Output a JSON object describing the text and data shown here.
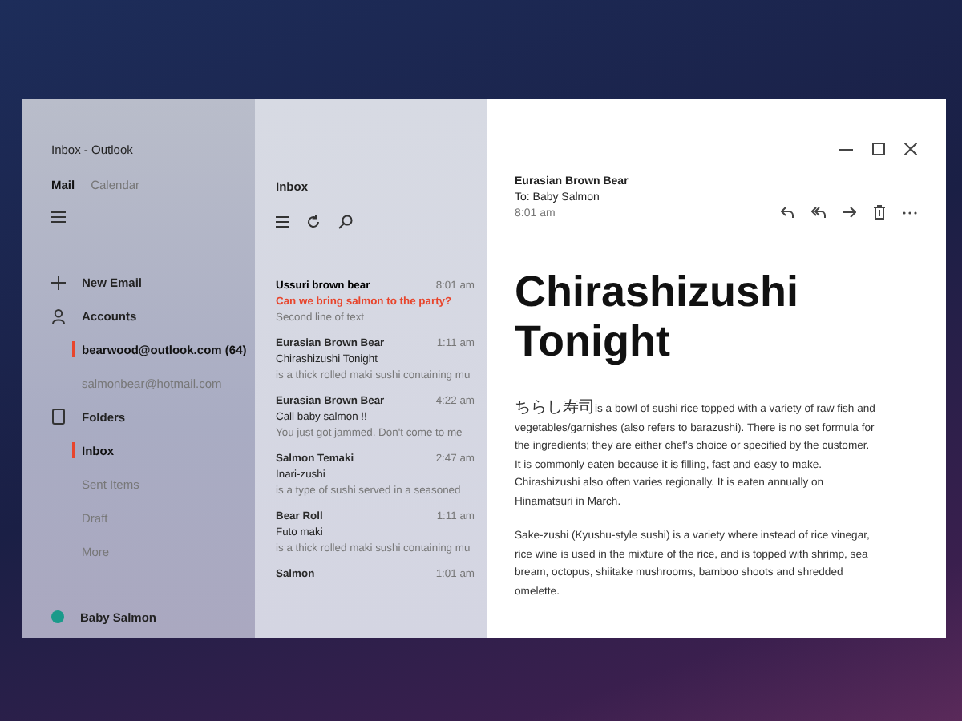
{
  "window": {
    "title": "Inbox - Outlook"
  },
  "nav_tabs": [
    {
      "label": "Mail",
      "selected": true
    },
    {
      "label": "Calendar",
      "selected": false
    }
  ],
  "sidebar": {
    "new_email": "New Email",
    "accounts": {
      "label": "Accounts",
      "items": [
        {
          "label": "bearwood@outlook.com (64)",
          "selected": true
        },
        {
          "label": "salmonbear@hotmail.com",
          "selected": false
        }
      ]
    },
    "folders": {
      "label": "Folders",
      "items": [
        {
          "label": "Inbox",
          "selected": true
        },
        {
          "label": "Sent Items",
          "selected": false
        },
        {
          "label": "Draft",
          "selected": false
        },
        {
          "label": "More",
          "selected": false
        }
      ]
    },
    "user": {
      "name": "Baby Salmon"
    }
  },
  "message_list": {
    "title": "Inbox",
    "messages": [
      {
        "sender": "Ussuri brown bear",
        "time": "8:01 am",
        "subject": "Can we bring salmon to the party?",
        "preview": "Second line of text",
        "unread": true
      },
      {
        "sender": "Eurasian Brown Bear",
        "time": "1:11 am",
        "subject": "Chirashizushi Tonight",
        "preview": "is a thick rolled maki sushi containing mu",
        "unread": false
      },
      {
        "sender": "Eurasian Brown Bear",
        "time": "4:22 am",
        "subject": "Call baby salmon !!",
        "preview": "You just got jammed. Don't come to me",
        "unread": false
      },
      {
        "sender": "Salmon Temaki",
        "time": "2:47 am",
        "subject": "Inari-zushi",
        "preview": "is a type of sushi served in a seasoned",
        "unread": false
      },
      {
        "sender": "Bear Roll",
        "time": "1:11 am",
        "subject": "Futo maki",
        "preview": "is a thick rolled maki sushi containing mu",
        "unread": false
      },
      {
        "sender": "Salmon",
        "time": "1:01 am",
        "unread": false
      }
    ]
  },
  "reading_pane": {
    "from": "Eurasian Brown Bear",
    "to": "To: Baby Salmon",
    "time": "8:01 am",
    "title": "Chirashizushi Tonight",
    "paragraphs": [
      {
        "term": "ちらし寿司",
        "text": "is a bowl of sushi rice topped with a variety of raw fish and vegetables/garnishes (also refers to barazushi). There is no set formula for the ingredients; they are either chef's choice or specified by the customer. It is commonly eaten because it is filling, fast and easy to make. Chirashizushi also often varies regionally. It is eaten annually on Hinamatsuri in March."
      },
      {
        "text": "Sake-zushi (Kyushu-style sushi) is a variety where instead of rice vinegar, rice wine is used in the mixture of the rice, and is topped with shrimp, sea bream, octopus, shiitake mushrooms, bamboo shoots and shredded omelette."
      }
    ]
  }
}
